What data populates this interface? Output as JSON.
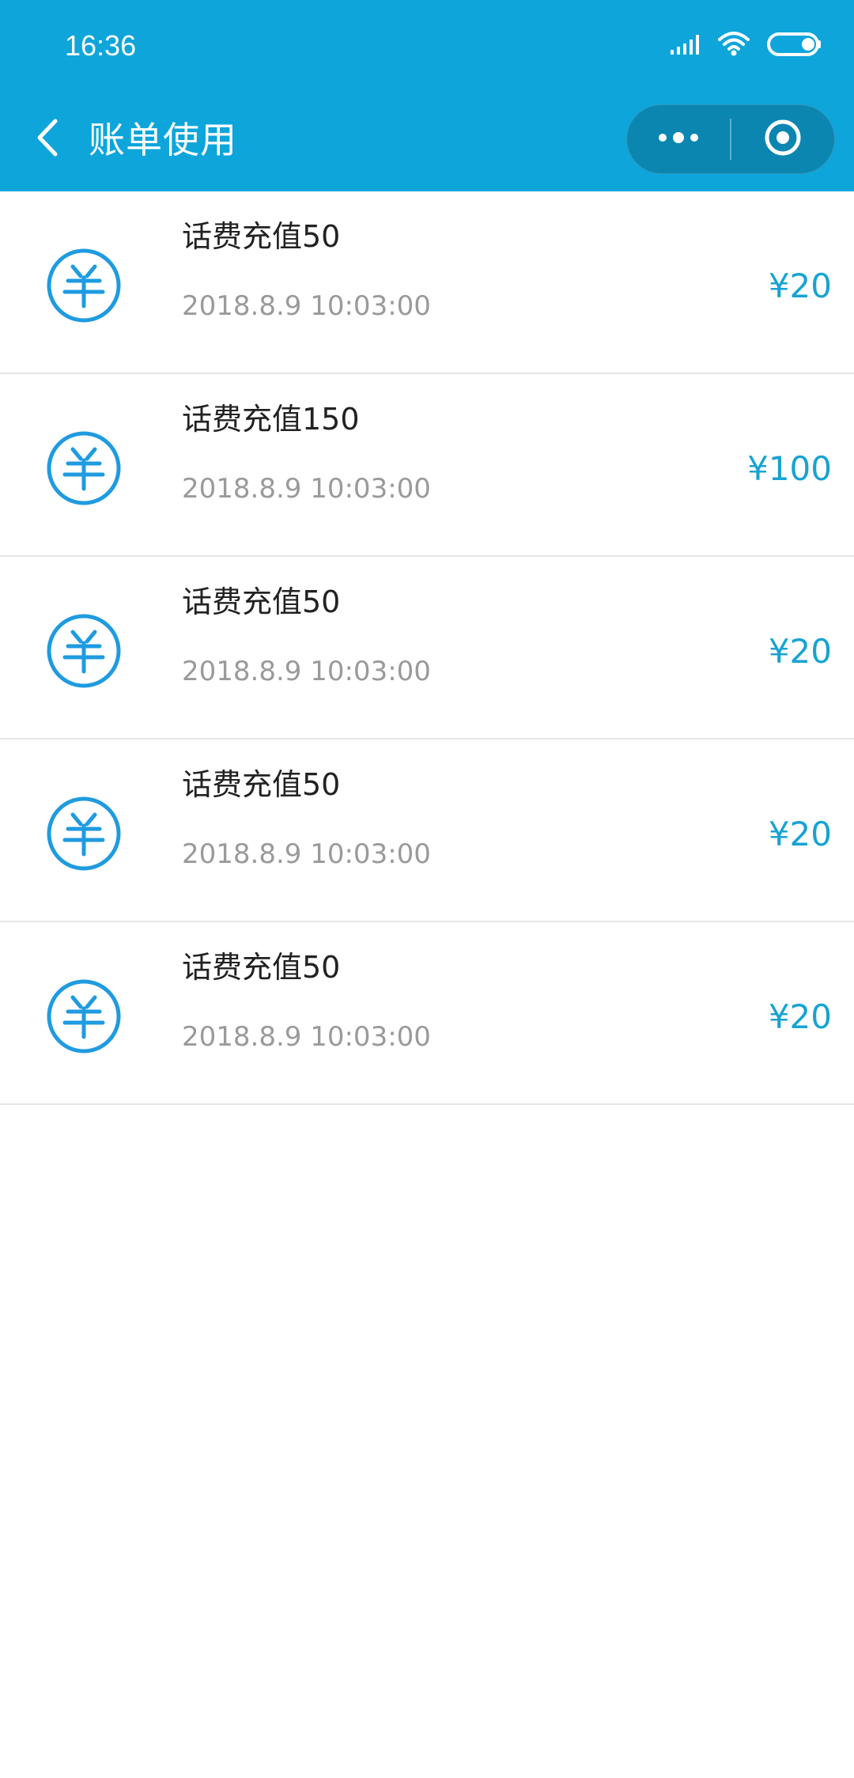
{
  "status_bar": {
    "time": "16:36",
    "icons": [
      "signal-icon",
      "wifi-icon",
      "battery-icon"
    ]
  },
  "nav": {
    "title": "账单使用",
    "back_icon": "chevron-left-icon",
    "more_icon": "more-dots-icon",
    "close_icon": "target-icon"
  },
  "colors": {
    "topbar": "#0ea5db",
    "capsule": "#0b86b1",
    "amount": "#17a3d3",
    "icon": "#1f9be0",
    "time_text": "#9a9a9a"
  },
  "bills": [
    {
      "title": "话费充值50",
      "time": "2018.8.9 10:03:00",
      "amount": "¥20",
      "icon": "yen-circle-icon"
    },
    {
      "title": "话费充值150",
      "time": "2018.8.9 10:03:00",
      "amount": "¥100",
      "icon": "yen-circle-icon"
    },
    {
      "title": "话费充值50",
      "time": "2018.8.9 10:03:00",
      "amount": "¥20",
      "icon": "yen-circle-icon"
    },
    {
      "title": "话费充值50",
      "time": "2018.8.9 10:03:00",
      "amount": "¥20",
      "icon": "yen-circle-icon"
    },
    {
      "title": "话费充值50",
      "time": "2018.8.9 10:03:00",
      "amount": "¥20",
      "icon": "yen-circle-icon"
    }
  ]
}
